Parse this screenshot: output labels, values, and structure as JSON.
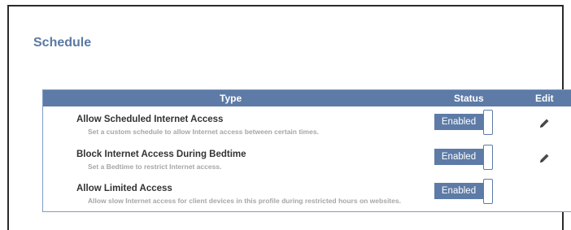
{
  "page": {
    "title": "Schedule"
  },
  "table": {
    "headers": {
      "type": "Type",
      "status": "Status",
      "edit": "Edit"
    },
    "rows": [
      {
        "title": "Allow Scheduled Internet Access",
        "description": "Set a custom schedule to allow Internet access between certain times.",
        "status": "Enabled",
        "editable": true
      },
      {
        "title": "Block Internet Access During Bedtime",
        "description": "Set a Bedtime to restrict Internet access.",
        "status": "Enabled",
        "editable": true
      },
      {
        "title": "Allow Limited Access",
        "description": "Allow slow Internet access for client devices in this profile during restricted hours on websites.",
        "status": "Enabled",
        "editable": false
      }
    ]
  },
  "icons": {
    "edit": "pencil-icon"
  },
  "colors": {
    "accent": "#5d7ba6",
    "title": "#5a7aa3",
    "description": "#a6a6a6"
  }
}
